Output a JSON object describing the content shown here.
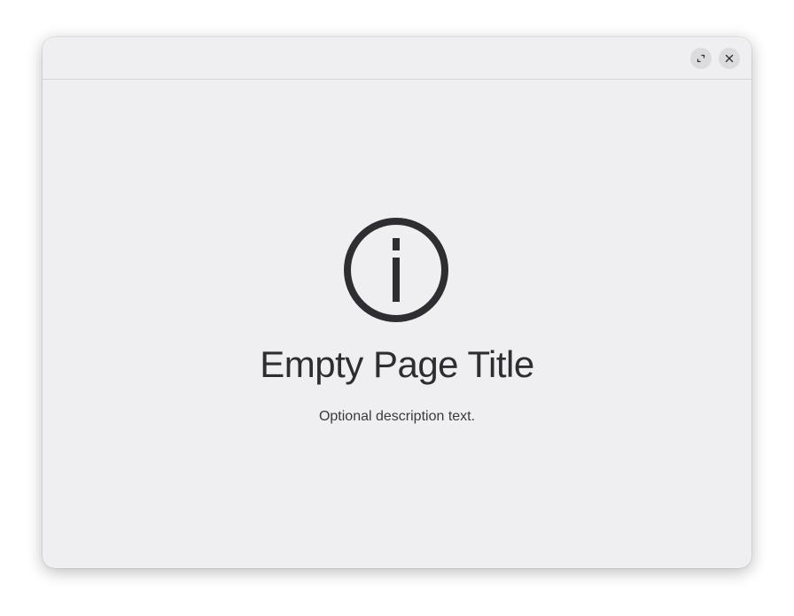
{
  "window": {
    "background": "#efeff1",
    "controls": {
      "maximize_icon": "maximize-icon",
      "close_icon": "close-icon"
    }
  },
  "status_page": {
    "icon": "info-icon",
    "icon_color": "#2e2e32",
    "title": "Empty Page Title",
    "description": "Optional description text."
  }
}
